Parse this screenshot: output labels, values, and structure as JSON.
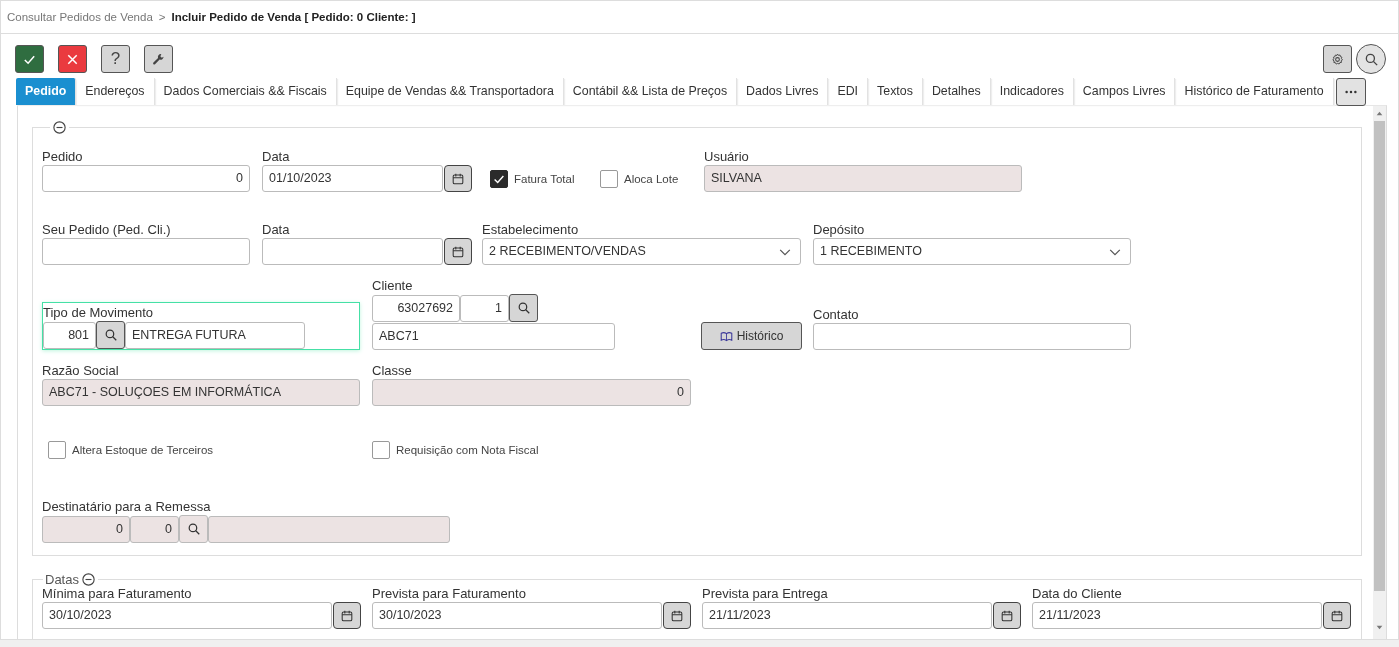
{
  "breadcrumb": {
    "items": [
      {
        "text": "Consultar Pedidos de Venda",
        "current": false
      },
      {
        "text": "Incluir Pedido de Venda [ Pedido: 0 Cliente: ]",
        "current": true
      }
    ],
    "separator": ">"
  },
  "toolbar": {
    "left": [
      {
        "kind": "confirm"
      },
      {
        "kind": "cancel"
      },
      {
        "kind": "help",
        "label": "?"
      },
      {
        "kind": "tools"
      }
    ],
    "right": [
      {
        "kind": "settings"
      },
      {
        "kind": "search"
      }
    ]
  },
  "tabs": [
    {
      "label": "Pedido",
      "selected": true
    },
    {
      "label": "Endereços",
      "selected": false
    },
    {
      "label": "Dados Comerciais && Fiscais",
      "selected": false
    },
    {
      "label": "Equipe de Vendas && Transportadora",
      "selected": false
    },
    {
      "label": "Contábil && Lista de Preços",
      "selected": false
    },
    {
      "label": "Dados Livres",
      "selected": false
    },
    {
      "label": "EDI",
      "selected": false
    },
    {
      "label": "Textos",
      "selected": false
    },
    {
      "label": "Detalhes",
      "selected": false
    },
    {
      "label": "Indicadores",
      "selected": false
    },
    {
      "label": "Campos Livres",
      "selected": false
    },
    {
      "label": "Histórico de Faturamento",
      "selected": false
    }
  ],
  "tab_overflow_menu": true,
  "main_section": {
    "expanded": true,
    "rows": [
      [
        {
          "kind": "number",
          "label": "Pedido",
          "value": "0",
          "readonly": false
        },
        {
          "kind": "date",
          "label": "Data",
          "value": "01/10/2023"
        },
        {
          "kind": "checkbox",
          "label": "Fatura Total",
          "checked": true
        },
        {
          "kind": "checkbox",
          "label": "Aloca Lote",
          "checked": false
        },
        {
          "kind": "text",
          "label": "Usuário",
          "value": "SILVANA",
          "readonly": true
        }
      ],
      [
        {
          "kind": "text",
          "label": "Seu Pedido (Ped. Cli.)",
          "readonly": false
        },
        {
          "kind": "date",
          "label": "Data"
        },
        {
          "kind": "select",
          "label": "Estabelecimento",
          "value": "2 RECEBIMENTO/VENDAS"
        },
        {
          "kind": "select",
          "label": "Depósito",
          "value": "1 RECEBIMENTO"
        }
      ],
      [
        {
          "kind": "lookup",
          "label": "Tipo de Movimento",
          "code": "801",
          "description": "ENTREGA FUTURA",
          "focused": true
        },
        {
          "kind": "client",
          "label": "Cliente",
          "code": "63027692",
          "branch": "1",
          "name": "ABC71"
        },
        {
          "kind": "button",
          "label": "Histórico"
        },
        {
          "kind": "text",
          "label": "Contato",
          "readonly": false
        }
      ],
      [
        {
          "kind": "text",
          "label": "Razão Social",
          "value": "ABC71 - SOLUÇOES EM INFORMÁTICA",
          "readonly": true
        },
        {
          "kind": "number",
          "label": "Classe",
          "value": "0",
          "readonly": true
        }
      ],
      [
        {
          "kind": "checkbox",
          "label": "Altera Estoque de Terceiros",
          "checked": false
        },
        {
          "kind": "checkbox",
          "label": "Requisição com Nota Fiscal",
          "checked": false
        }
      ],
      [
        {
          "kind": "recipient",
          "label": "Destinatário para a Remessa",
          "code": "0",
          "branch": "0",
          "readonly": true
        }
      ]
    ]
  },
  "dates_section": {
    "title": "Datas",
    "expanded": true,
    "fields": [
      {
        "label": "Mínima para Faturamento",
        "value": "30/10/2023"
      },
      {
        "label": "Prevista para Faturamento",
        "value": "30/10/2023"
      },
      {
        "label": "Prevista para Entrega",
        "value": "21/11/2023"
      },
      {
        "label": "Data do Cliente",
        "value": "21/11/2023"
      }
    ]
  }
}
